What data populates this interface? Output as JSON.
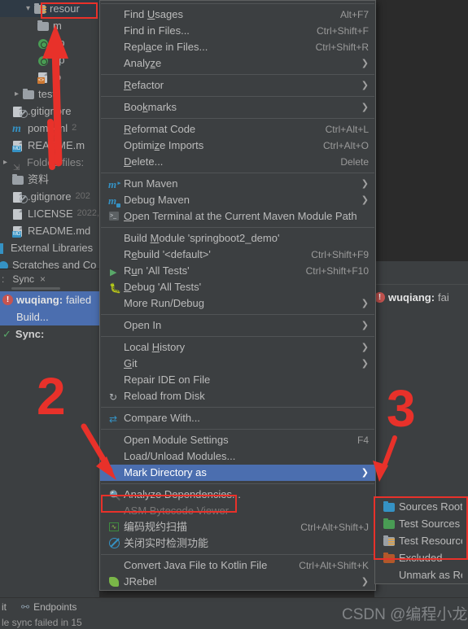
{
  "project_tree": {
    "items": [
      {
        "indent": 2,
        "arrow": "v",
        "icon": "folder-resources-icon",
        "label": "resour",
        "date": "",
        "selected": true
      },
      {
        "indent": 3,
        "arrow": "",
        "icon": "folder-icon",
        "label": "m",
        "date": "",
        "selected": false
      },
      {
        "indent": 3,
        "arrow": "",
        "icon": "spring-yaml-icon",
        "label": "ap",
        "date": "",
        "selected": false
      },
      {
        "indent": 3,
        "arrow": "",
        "icon": "spring-yaml-icon",
        "label": "ap",
        "date": "",
        "selected": false
      },
      {
        "indent": 3,
        "arrow": "",
        "icon": "xml-file-icon",
        "label": "lo",
        "date": "",
        "selected": false
      },
      {
        "indent": 2,
        "arrow": ">",
        "icon": "folder-icon",
        "label": "test",
        "date": "",
        "selected": false
      },
      {
        "indent": 1,
        "arrow": "",
        "icon": "gitignore-icon",
        "label": ".gitignore",
        "date": "",
        "selected": false
      },
      {
        "indent": 1,
        "arrow": "",
        "icon": "maven-icon",
        "label": "pom.xml",
        "date": "2",
        "selected": false
      },
      {
        "indent": 1,
        "arrow": "",
        "icon": "markdown-icon",
        "label": "README.m",
        "date": "",
        "selected": false
      },
      {
        "indent": 0,
        "arrow": ">",
        "icon": "folded-files-icon",
        "label": "Folded files:",
        "date": "",
        "selected": false
      },
      {
        "indent": 1,
        "arrow": "",
        "icon": "folder-icon",
        "label": "资料",
        "date": "",
        "selected": false
      },
      {
        "indent": 1,
        "arrow": "",
        "icon": "gitignore-icon",
        "label": ".gitignore",
        "date": "202",
        "selected": false
      },
      {
        "indent": 1,
        "arrow": "",
        "icon": "license-icon",
        "label": "LICENSE",
        "date": "2022,",
        "selected": false
      },
      {
        "indent": 1,
        "arrow": "",
        "icon": "markdown-icon",
        "label": "README.md",
        "date": "",
        "selected": false
      },
      {
        "indent": 0,
        "arrow": "",
        "icon": "external-libraries-icon",
        "label": "External Libraries",
        "date": "",
        "selected": false
      },
      {
        "indent": 0,
        "arrow": "",
        "icon": "scratches-icon",
        "label": "Scratches and Co",
        "date": "",
        "selected": false
      }
    ]
  },
  "sync_window": {
    "tab_prefix": ":",
    "tab_label": "Sync",
    "close_icon": "×",
    "rows": [
      {
        "icon": "error-icon",
        "bold": "wuqiang:",
        "rest": "failed",
        "selected": true
      },
      {
        "icon": "",
        "bold": "",
        "rest": "Build...",
        "selected": true
      },
      {
        "icon": "success-icon",
        "bold": "Sync:",
        "rest": "",
        "selected": false
      }
    ]
  },
  "right_panel": {
    "build_error_icon": "error-icon",
    "build_bold": "wuqiang:",
    "build_rest": "fai"
  },
  "status_bar": {
    "left_text": "it",
    "endpoints_label": "Endpoints",
    "sync_failed_text": "le sync failed in 15"
  },
  "context_menu": {
    "items": [
      {
        "type": "separator"
      },
      {
        "type": "item",
        "icon": "",
        "label": "Find Usages",
        "mnemonic": "U",
        "shortcut": "Alt+F7",
        "submenu": false,
        "disabled": false
      },
      {
        "type": "item",
        "icon": "",
        "label": "Find in Files...",
        "mnemonic": "",
        "shortcut": "Ctrl+Shift+F",
        "submenu": false,
        "disabled": false
      },
      {
        "type": "item",
        "icon": "",
        "label": "Replace in Files...",
        "mnemonic": "a",
        "shortcut": "Ctrl+Shift+R",
        "submenu": false,
        "disabled": false
      },
      {
        "type": "item",
        "icon": "",
        "label": "Analyze",
        "mnemonic": "z",
        "shortcut": "",
        "submenu": true,
        "disabled": false
      },
      {
        "type": "separator"
      },
      {
        "type": "item",
        "icon": "",
        "label": "Refactor",
        "mnemonic": "R",
        "shortcut": "",
        "submenu": true,
        "disabled": false
      },
      {
        "type": "separator"
      },
      {
        "type": "item",
        "icon": "",
        "label": "Bookmarks",
        "mnemonic": "k",
        "shortcut": "",
        "submenu": true,
        "disabled": false
      },
      {
        "type": "separator"
      },
      {
        "type": "item",
        "icon": "",
        "label": "Reformat Code",
        "mnemonic": "R",
        "shortcut": "Ctrl+Alt+L",
        "submenu": false,
        "disabled": false
      },
      {
        "type": "item",
        "icon": "",
        "label": "Optimize Imports",
        "mnemonic": "z",
        "shortcut": "Ctrl+Alt+O",
        "submenu": false,
        "disabled": false
      },
      {
        "type": "item",
        "icon": "",
        "label": "Delete...",
        "mnemonic": "D",
        "shortcut": "Delete",
        "submenu": false,
        "disabled": false
      },
      {
        "type": "separator"
      },
      {
        "type": "item",
        "icon": "run-maven-icon",
        "label": "Run Maven",
        "mnemonic": "",
        "shortcut": "",
        "submenu": true,
        "disabled": false
      },
      {
        "type": "item",
        "icon": "debug-maven-icon",
        "label": "Debug Maven",
        "mnemonic": "",
        "shortcut": "",
        "submenu": true,
        "disabled": false
      },
      {
        "type": "item",
        "icon": "terminal-icon",
        "label": "Open Terminal at the Current Maven Module Path",
        "mnemonic": "O",
        "shortcut": "",
        "submenu": false,
        "disabled": false
      },
      {
        "type": "separator"
      },
      {
        "type": "item",
        "icon": "",
        "label": "Build Module 'springboot2_demo'",
        "mnemonic": "M",
        "shortcut": "",
        "submenu": false,
        "disabled": false
      },
      {
        "type": "item",
        "icon": "",
        "label": "Rebuild '<default>'",
        "mnemonic": "e",
        "shortcut": "Ctrl+Shift+F9",
        "submenu": false,
        "disabled": false
      },
      {
        "type": "item",
        "icon": "run-icon",
        "label": "Run 'All Tests'",
        "mnemonic": "u",
        "shortcut": "Ctrl+Shift+F10",
        "submenu": false,
        "disabled": false
      },
      {
        "type": "item",
        "icon": "debug-icon",
        "label": "Debug 'All Tests'",
        "mnemonic": "D",
        "shortcut": "",
        "submenu": false,
        "disabled": false
      },
      {
        "type": "item",
        "icon": "",
        "label": "More Run/Debug",
        "mnemonic": "",
        "shortcut": "",
        "submenu": true,
        "disabled": false
      },
      {
        "type": "separator"
      },
      {
        "type": "item",
        "icon": "",
        "label": "Open In",
        "mnemonic": "",
        "shortcut": "",
        "submenu": true,
        "disabled": false
      },
      {
        "type": "separator"
      },
      {
        "type": "item",
        "icon": "",
        "label": "Local History",
        "mnemonic": "H",
        "shortcut": "",
        "submenu": true,
        "disabled": false
      },
      {
        "type": "item",
        "icon": "",
        "label": "Git",
        "mnemonic": "G",
        "shortcut": "",
        "submenu": true,
        "disabled": false
      },
      {
        "type": "item",
        "icon": "",
        "label": "Repair IDE on File",
        "mnemonic": "",
        "shortcut": "",
        "submenu": false,
        "disabled": false
      },
      {
        "type": "item",
        "icon": "reload-icon",
        "label": "Reload from Disk",
        "mnemonic": "",
        "shortcut": "",
        "submenu": false,
        "disabled": false
      },
      {
        "type": "separator"
      },
      {
        "type": "item",
        "icon": "compare-icon",
        "label": "Compare With...",
        "mnemonic": "",
        "shortcut": "",
        "submenu": false,
        "disabled": false
      },
      {
        "type": "separator"
      },
      {
        "type": "item",
        "icon": "",
        "label": "Open Module Settings",
        "mnemonic": "",
        "shortcut": "F4",
        "submenu": false,
        "disabled": false
      },
      {
        "type": "item",
        "icon": "",
        "label": "Load/Unload Modules...",
        "mnemonic": "",
        "shortcut": "",
        "submenu": false,
        "disabled": false
      },
      {
        "type": "item",
        "icon": "",
        "label": "Mark Directory as",
        "mnemonic": "",
        "shortcut": "",
        "submenu": true,
        "disabled": false,
        "selected": true
      },
      {
        "type": "separator"
      },
      {
        "type": "item",
        "icon": "analyze-dependencies-icon",
        "label": "Analyze Dependencies...",
        "mnemonic": "",
        "shortcut": "",
        "submenu": false,
        "disabled": false
      },
      {
        "type": "item",
        "icon": "",
        "label": "ASM Bytecode Viewer",
        "mnemonic": "",
        "shortcut": "",
        "submenu": false,
        "disabled": true
      },
      {
        "type": "item",
        "icon": "code-scan-icon",
        "label": "编码规约扫描",
        "mnemonic": "",
        "shortcut": "Ctrl+Alt+Shift+J",
        "submenu": false,
        "disabled": false
      },
      {
        "type": "item",
        "icon": "disable-inspection-icon",
        "label": "关闭实时检测功能",
        "mnemonic": "",
        "shortcut": "",
        "submenu": false,
        "disabled": false
      },
      {
        "type": "separator"
      },
      {
        "type": "item",
        "icon": "",
        "label": "Convert Java File to Kotlin File",
        "mnemonic": "",
        "shortcut": "Ctrl+Alt+Shift+K",
        "submenu": false,
        "disabled": false
      },
      {
        "type": "item",
        "icon": "jrebel-icon",
        "label": "JRebel",
        "mnemonic": "",
        "shortcut": "",
        "submenu": true,
        "disabled": false
      }
    ]
  },
  "submenu": {
    "items": [
      {
        "icon": "sources-root-icon",
        "label": "Sources Root"
      },
      {
        "icon": "test-sources-root-icon",
        "label": "Test Sources R"
      },
      {
        "icon": "test-resources-root-icon",
        "label": "Test Resources"
      },
      {
        "icon": "excluded-icon",
        "label": "Excluded"
      },
      {
        "icon": "",
        "label": "Unmark as Res"
      }
    ]
  },
  "annotations": {
    "number_2": "2",
    "number_3": "3",
    "watermark": "CSDN @编程小龙"
  },
  "colors": {
    "menu_bg": "#3c3f41",
    "editor_bg": "#2b2b2b",
    "selection_blue": "#4b6eaf",
    "annotation_red": "#e8312a",
    "error_red": "#c75450",
    "success_green": "#59a869"
  }
}
